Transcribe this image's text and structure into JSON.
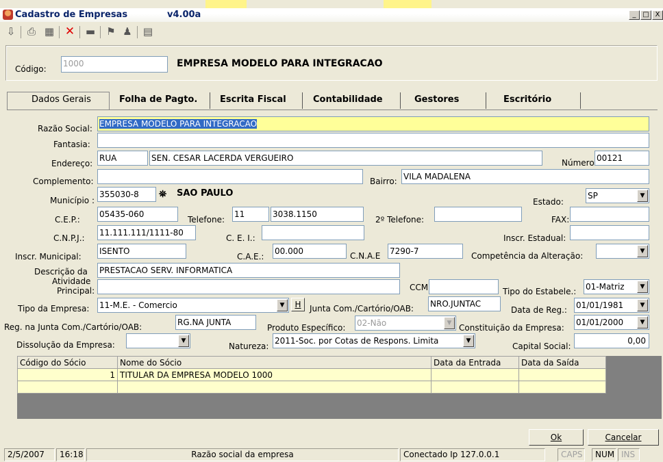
{
  "window": {
    "title": "Cadastro de Empresas",
    "version": "v4.00a",
    "buttons": [
      "_",
      "□",
      "X"
    ]
  },
  "toolbar_icons": [
    "exit-icon",
    "print-icon",
    "grid-icon",
    "delete-icon",
    "folder-icon",
    "flag-icon",
    "user-icon",
    "notes-icon"
  ],
  "header": {
    "codigo_label": "Código:",
    "codigo_value": "1000",
    "company_name": "EMPRESA MODELO PARA INTEGRACAO"
  },
  "tabs": [
    "Dados Gerais",
    "Folha de Pagto.",
    "Escrita Fiscal",
    "Contabilidade",
    "Gestores",
    "Escritório"
  ],
  "form": {
    "razao_label": "Razão Social:",
    "razao_value": "EMPRESA MODELO PARA INTEGRACAO",
    "fantasia_label": "Fantasia:",
    "fantasia_value": "",
    "endereco_label": "Endereço:",
    "endereco_tipo": "RUA",
    "endereco_value": "SEN. CESAR LACERDA VERGUEIRO",
    "numero_label": "Número:",
    "numero_value": "00121",
    "complemento_label": "Complemento:",
    "complemento_value": "",
    "bairro_label": "Bairro:",
    "bairro_value": "VILA MADALENA",
    "municipio_label": "Município :",
    "municipio_code": "355030-8",
    "municipio_name": "SAO PAULO",
    "estado_label": "Estado:",
    "estado_value": "SP",
    "cep_label": "C.E.P.:",
    "cep_value": "05435-060",
    "telefone_label": "Telefone:",
    "telefone_ddd": "11",
    "telefone_value": "3038.1150",
    "telefone2_label": "2º Telefone:",
    "telefone2_value": "",
    "fax_label": "FAX:",
    "fax_value": "",
    "cnpj_label": "C.N.P.J.:",
    "cnpj_value": "11.111.111/1111-80",
    "cei_label": "C. E. I.:",
    "cei_value": "",
    "inscr_estadual_label": "Inscr. Estadual:",
    "inscr_estadual_value": "",
    "inscr_municipal_label": "Inscr. Municipal:",
    "inscr_municipal_value": "ISENTO",
    "cae_label": "C.A.E.:",
    "cae_value": "00.000",
    "cnae_label": "C.N.A.E",
    "cnae_value": "7290-7",
    "competencia_label": "Competência da Alteração:",
    "competencia_value": "",
    "descricao_label_1": "Descrição da",
    "descricao_label_2": "Atividade",
    "descricao_label_3": "Principal:",
    "descricao_value": "PRESTACAO SERV. INFORMATICA",
    "descricao_value2": "",
    "ccm_label": "CCM:",
    "ccm_value": "",
    "tipo_estab_label": "Tipo do Estabele.:",
    "tipo_estab_value": "01-Matriz",
    "tipo_empresa_label": "Tipo da Empresa:",
    "tipo_empresa_value": "11-M.E. - Comercio",
    "h_button": "H",
    "junta_label": "Junta Com./Cartório/OAB:",
    "junta_value": "NRO.JUNTAC",
    "data_reg_label": "Data de Reg.:",
    "data_reg_value": "01/01/1981",
    "reg_junta_label": "Reg. na Junta Com./Cartório/OAB:",
    "reg_junta_value": "RG.NA JUNTA",
    "produto_label": "Produto Específico:",
    "produto_value": "02-Não",
    "constituicao_label": "Constituição da Empresa:",
    "constituicao_value": "01/01/2000",
    "dissolucao_label": "Dissolução da Empresa:",
    "dissolucao_value": "",
    "natureza_label": "Natureza:",
    "natureza_value": "2011-Soc. por Cotas de Respons. Limita",
    "capital_label": "Capital Social:",
    "capital_value": "0,00"
  },
  "grid": {
    "headers": [
      "Código do Sócio",
      "Nome do Sócio",
      "Data da Entrada",
      "Data da Saída"
    ],
    "rows": [
      [
        "1",
        "TITULAR DA EMPRESA MODELO 1000",
        "",
        ""
      ],
      [
        "",
        "",
        "",
        ""
      ]
    ]
  },
  "buttons": {
    "ok": "Ok",
    "cancelar": "Cancelar"
  },
  "status": {
    "date": "2/5/2007",
    "time": "16:18",
    "message": "Razão social da empresa",
    "connection": "Conectado Ip 127.0.0.1",
    "caps": "CAPS",
    "num": "NUM",
    "ins": "INS"
  }
}
